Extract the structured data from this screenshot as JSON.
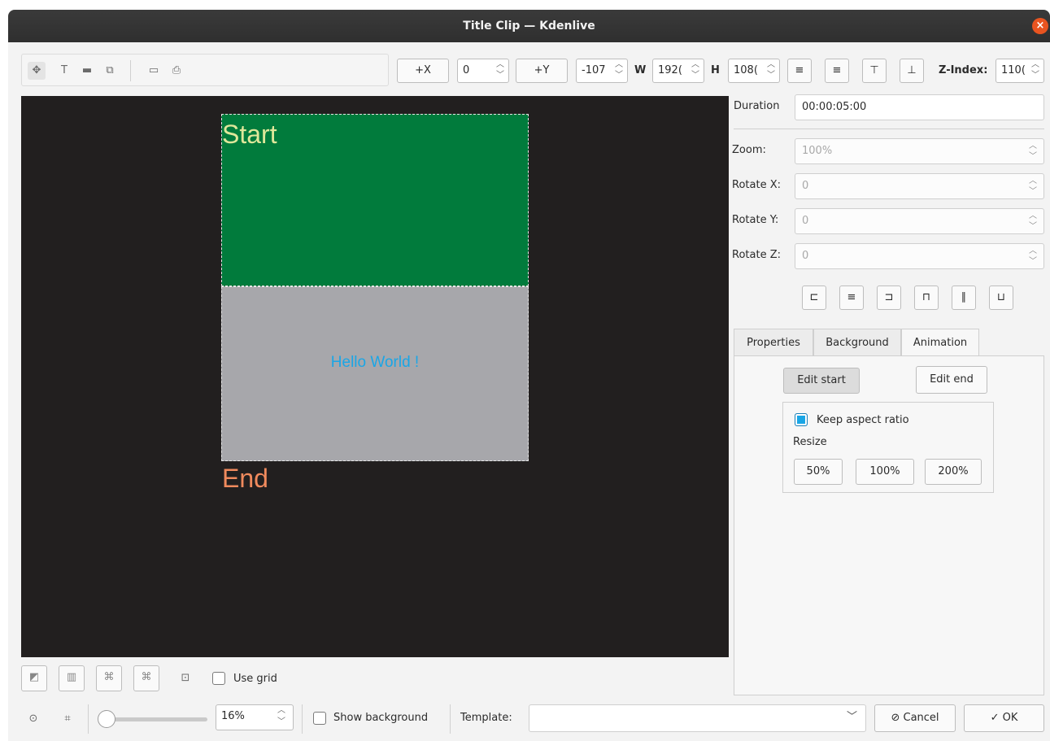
{
  "window": {
    "title": "Title Clip — Kdenlive"
  },
  "toolbar": {
    "tools": [
      "select-tool",
      "text-tool",
      "rectangle-tool",
      "image-tool",
      "open-document",
      "save-document"
    ],
    "plus_x": "+X",
    "x_value": "0",
    "plus_y": "+Y",
    "y_value": "-107",
    "w_label": "W",
    "w_value": "192(",
    "h_label": "H",
    "h_value": "108(",
    "zindex_label": "Z-Index:",
    "zindex_value": "110("
  },
  "canvas": {
    "start_label": "Start",
    "end_label": "End",
    "text_item": "Hello World !"
  },
  "panel": {
    "duration_label": "Duration",
    "duration_value": "00:00:05:00",
    "zoom_label": "Zoom:",
    "zoom_value": "100%",
    "rotate_x_label": "Rotate X:",
    "rotate_x_value": "0",
    "rotate_y_label": "Rotate Y:",
    "rotate_y_value": "0",
    "rotate_z_label": "Rotate Z:",
    "rotate_z_value": "0",
    "tabs": [
      "Properties",
      "Background",
      "Animation"
    ],
    "active_tab": "Animation",
    "edit_start": "Edit start",
    "edit_end": "Edit end",
    "keep_aspect": "Keep aspect ratio",
    "keep_aspect_checked": true,
    "resize_label": "Resize",
    "resize_50": "50%",
    "resize_100": "100%",
    "resize_200": "200%"
  },
  "bottom": {
    "use_grid": "Use grid",
    "zoom_value": "16%",
    "show_background": "Show background",
    "template_label": "Template:",
    "template_value": "",
    "cancel": "Cancel",
    "ok": "OK"
  },
  "colors": {
    "canvas_bg": "#221f1f",
    "start_rect": "#017b3c",
    "end_rect": "#a7a7ab",
    "start_text": "#dfe79a",
    "end_text": "#f08a5d",
    "hello_text": "#1aa6e6",
    "close_button": "#e95420"
  }
}
